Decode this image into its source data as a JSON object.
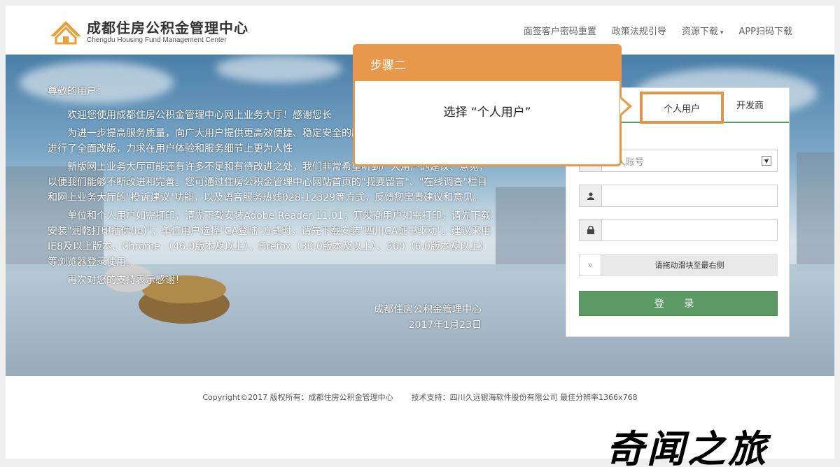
{
  "header": {
    "title_cn": "成都住房公积金管理中心",
    "title_en": "Chengdu Housing Fund Management Center",
    "nav": [
      {
        "label": "面签客户密码重置"
      },
      {
        "label": "政策法规引导"
      },
      {
        "label": "资源下载"
      },
      {
        "label": "APP扫码下载"
      }
    ],
    "dropdown_caret": "▾"
  },
  "notice": {
    "greeting": "尊敬的用户：",
    "paragraphs": [
      "欢迎您使用成都住房公积金管理中心网上业务大厅！感谢您长",
      "为进一步提高服务质量，向广大用户提供更高效便捷、稳定安全的服务，我们对网上业务服务渠道进行了全面改版，力求在用户体验和服务细节上更为人性",
      "新版网上业务大厅可能还有许多不足和有待改进之处，我们非常希望听到广大用户的建议、意见，以便我们能够不断改进和完善。您可通过住房公积金管理中心网站首页的\"我要留言\"、\"在线调查\"栏目和网上业务大厅的\"投诉建议\"功能，以及语音服务热线028-12329等方式，反馈您宝贵建议和意见。",
      "单位和个人用户如需打印，请先下载安装Adobe Reader 11.01；开发商用户如需打印，请先下载安装\"润乾打印插件(ie)\"；单位用户选择\"CA登陆\"方式时，请先下载安装\"四川CA证书驱动\"。建议采用IE8及以上版本、Chrome （46.0版本及以上）、Firefox（30.0版本及以上）、360（6.0版本及以上）等浏览器登录使用。",
      "再次对您的支持表示感谢！"
    ],
    "signature": "成都住房公积金管理中心",
    "date": "2017年1月23日"
  },
  "login": {
    "tabs": [
      {
        "label": "个人用户"
      },
      {
        "label": "开发商"
      }
    ],
    "account_placeholder": "个人账号",
    "slider_hint": "请拖动滑块至最右侧",
    "slider_handle": "»",
    "login_label": "登 录"
  },
  "step_popup": {
    "title": "步骤二",
    "body": "选择 “个人用户”"
  },
  "footer": {
    "copyright": "Copyright©2017 版权所有：成都住房公积金管理中心",
    "support": "技术支持：四川久远银海软件股份有限公司 最佳分辨率1366x768"
  },
  "watermark": "奇闻之旅",
  "colors": {
    "accent_orange": "#e8984a",
    "login_green": "#5a9a63"
  },
  "icons": [
    "house-logo-icon",
    "user-icon",
    "lock-icon",
    "chevron-down-icon"
  ]
}
